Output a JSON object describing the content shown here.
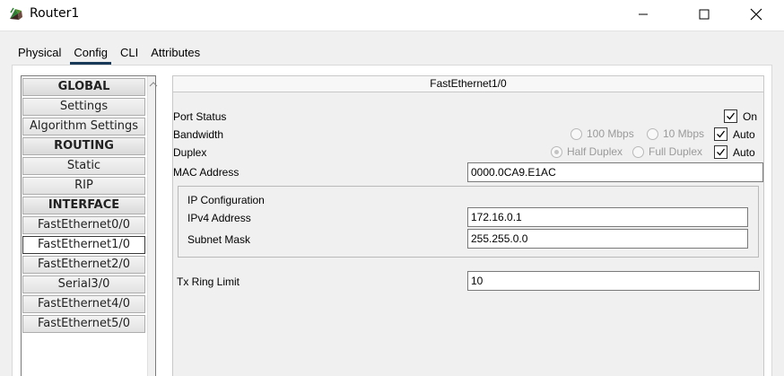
{
  "window": {
    "title": "Router1",
    "app_icon": "router-icon"
  },
  "tabs": [
    {
      "label": "Physical"
    },
    {
      "label": "Config"
    },
    {
      "label": "CLI"
    },
    {
      "label": "Attributes"
    }
  ],
  "active_tab": "Config",
  "nav": {
    "items": [
      {
        "label": "GLOBAL",
        "type": "header"
      },
      {
        "label": "Settings",
        "type": "item"
      },
      {
        "label": "Algorithm Settings",
        "type": "item"
      },
      {
        "label": "ROUTING",
        "type": "header"
      },
      {
        "label": "Static",
        "type": "item"
      },
      {
        "label": "RIP",
        "type": "item"
      },
      {
        "label": "INTERFACE",
        "type": "header"
      },
      {
        "label": "FastEthernet0/0",
        "type": "item"
      },
      {
        "label": "FastEthernet1/0",
        "type": "item"
      },
      {
        "label": "FastEthernet2/0",
        "type": "item"
      },
      {
        "label": "Serial3/0",
        "type": "item"
      },
      {
        "label": "FastEthernet4/0",
        "type": "item"
      },
      {
        "label": "FastEthernet5/0",
        "type": "item"
      }
    ],
    "selected": "FastEthernet1/0"
  },
  "panel": {
    "title": "FastEthernet1/0",
    "port_status": {
      "label": "Port Status",
      "on_label": "On",
      "checked": true
    },
    "bandwidth": {
      "label": "Bandwidth",
      "opt1": "100 Mbps",
      "opt2": "10 Mbps",
      "auto_label": "Auto",
      "auto_checked": true
    },
    "duplex": {
      "label": "Duplex",
      "opt1": "Half Duplex",
      "opt2": "Full Duplex",
      "auto_label": "Auto",
      "auto_checked": true
    },
    "mac": {
      "label": "MAC Address",
      "value": "0000.0CA9.E1AC"
    },
    "ip_config": {
      "title": "IP Configuration",
      "ipv4_label": "IPv4 Address",
      "ipv4_value": "172.16.0.1",
      "mask_label": "Subnet Mask",
      "mask_value": "255.255.0.0"
    },
    "tx_ring": {
      "label": "Tx Ring Limit",
      "value": "10"
    }
  }
}
